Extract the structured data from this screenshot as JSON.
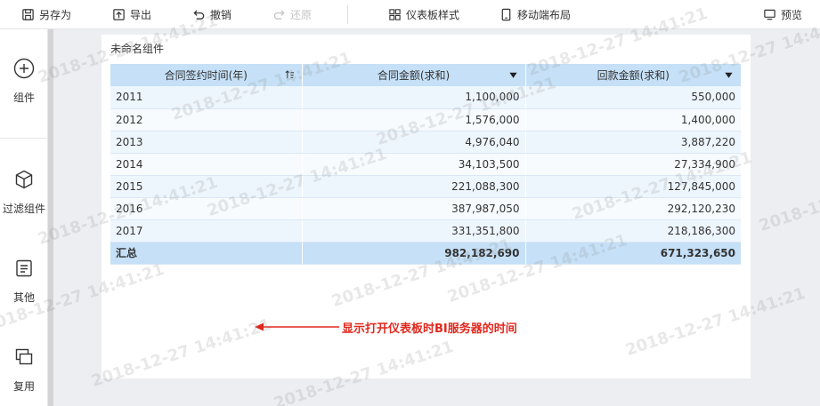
{
  "toolbar": {
    "save_as": "另存为",
    "export": "导出",
    "undo": "撤销",
    "redo": "还原",
    "dashboard_style": "仪表板样式",
    "mobile_layout": "移动端布局",
    "preview": "预览"
  },
  "sidebar": {
    "components": "组件",
    "filter_components": "过滤组件",
    "other": "其他",
    "reuse": "复用"
  },
  "widget": {
    "title": "未命名组件",
    "columns": [
      "合同签约时间(年)",
      "合同金额(求和)",
      "回款金额(求和)"
    ],
    "rows": [
      [
        "2011",
        "1,100,000",
        "550,000"
      ],
      [
        "2012",
        "1,576,000",
        "1,400,000"
      ],
      [
        "2013",
        "4,976,040",
        "3,887,220"
      ],
      [
        "2014",
        "34,103,500",
        "27,334,900"
      ],
      [
        "2015",
        "221,088,300",
        "127,845,000"
      ],
      [
        "2016",
        "387,987,050",
        "292,120,230"
      ],
      [
        "2017",
        "331,351,800",
        "218,186,300"
      ]
    ],
    "total": [
      "汇总",
      "982,182,690",
      "671,323,650"
    ]
  },
  "annotation": "显示打开仪表板时BI服务器的时间",
  "watermark": "2018-12-27 14:41:21",
  "colors": {
    "header_bg": "#c5e0f7",
    "row_odd": "#eef6fd",
    "row_even": "#f7fbfe",
    "annotation": "#e0271d"
  }
}
